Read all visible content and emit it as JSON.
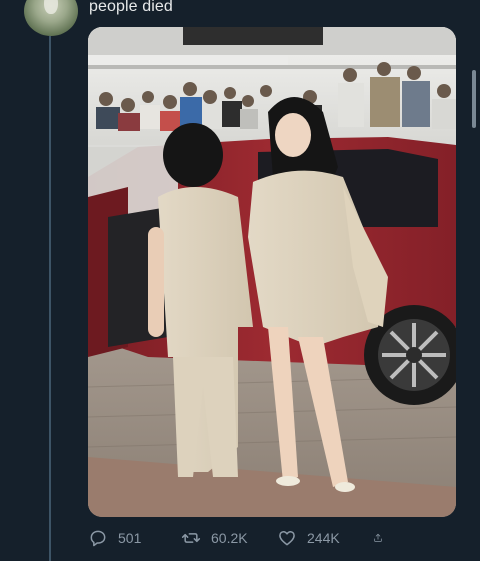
{
  "tweet": {
    "text": "people died",
    "stats": {
      "replies": "501",
      "retweets": "60.2K",
      "likes": "244K"
    }
  },
  "icons": {
    "reply": "reply-icon",
    "retweet": "retweet-icon",
    "like": "like-icon",
    "share": "share-icon"
  },
  "colors": {
    "background": "#15202b",
    "icon_gray": "#8b98a5",
    "thread_line": "#3d5466"
  }
}
